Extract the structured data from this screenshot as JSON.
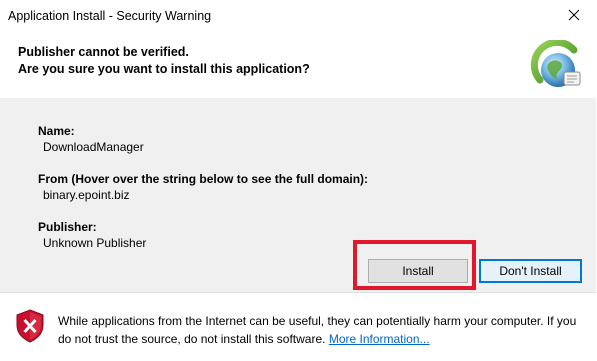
{
  "window": {
    "title": "Application Install - Security Warning"
  },
  "header": {
    "line1": "Publisher cannot be verified.",
    "line2": "Are you sure you want to install this application?",
    "icon": "globe-install-icon"
  },
  "details": {
    "name_label": "Name:",
    "name_value": "DownloadManager",
    "from_label": "From (Hover over the string below to see the full domain):",
    "from_value": "binary.epoint.biz",
    "publisher_label": "Publisher:",
    "publisher_value": "Unknown Publisher"
  },
  "buttons": {
    "install_label": "Install",
    "dont_install_label": "Don't Install"
  },
  "footer": {
    "warning_text": "While applications from the Internet can be useful, they can potentially harm your computer. If you do not trust the source, do not install this software.",
    "link_text": "More Information...",
    "icon": "security-shield-warning-icon"
  },
  "colors": {
    "highlight_border": "#e0182a",
    "default_button_border": "#0078d7",
    "link": "#0066cc",
    "body_background": "#f0f0f0"
  }
}
